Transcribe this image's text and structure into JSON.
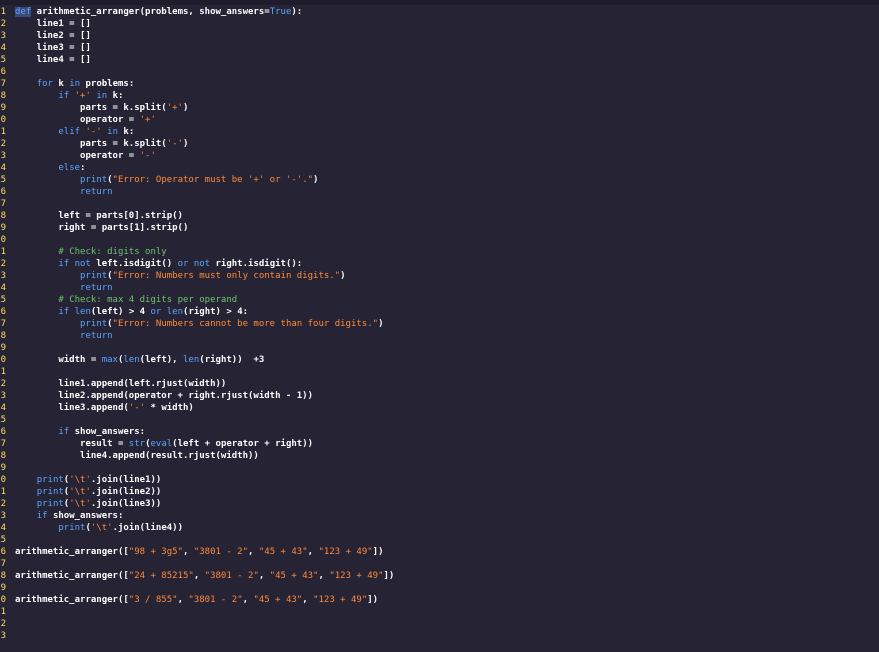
{
  "lines": [
    [
      [
        "sel",
        "def"
      ],
      [
        "p",
        " arithmetic_arranger(problems, show_answers="
      ],
      [
        "b",
        "True"
      ],
      [
        "p",
        "):"
      ]
    ],
    [
      [
        "p",
        "    line1 = []"
      ]
    ],
    [
      [
        "p",
        "    line2 = []"
      ]
    ],
    [
      [
        "p",
        "    line3 = []"
      ]
    ],
    [
      [
        "p",
        "    line4 = []"
      ]
    ],
    [],
    [
      [
        "p",
        "    "
      ],
      [
        "b",
        "for"
      ],
      [
        "p",
        " k "
      ],
      [
        "b",
        "in"
      ],
      [
        "p",
        " problems:"
      ]
    ],
    [
      [
        "p",
        "        "
      ],
      [
        "b",
        "if"
      ],
      [
        "p",
        " "
      ],
      [
        "s",
        "'+'"
      ],
      [
        "p",
        " "
      ],
      [
        "b",
        "in"
      ],
      [
        "p",
        " k:"
      ]
    ],
    [
      [
        "p",
        "            parts = k.split("
      ],
      [
        "s",
        "'+'"
      ],
      [
        "p",
        ")"
      ]
    ],
    [
      [
        "p",
        "            operator = "
      ],
      [
        "s",
        "'+'"
      ]
    ],
    [
      [
        "p",
        "        "
      ],
      [
        "b",
        "elif"
      ],
      [
        "p",
        " "
      ],
      [
        "s",
        "'-'"
      ],
      [
        "p",
        " "
      ],
      [
        "b",
        "in"
      ],
      [
        "p",
        " k:"
      ]
    ],
    [
      [
        "p",
        "            parts = k.split("
      ],
      [
        "s",
        "'-'"
      ],
      [
        "p",
        ")"
      ]
    ],
    [
      [
        "p",
        "            operator = "
      ],
      [
        "s",
        "'-'"
      ]
    ],
    [
      [
        "p",
        "        "
      ],
      [
        "b",
        "else"
      ],
      [
        "p",
        ":"
      ]
    ],
    [
      [
        "p",
        "            "
      ],
      [
        "b",
        "print"
      ],
      [
        "p",
        "("
      ],
      [
        "s",
        "\"Error: Operator must be '+' or '-'.\""
      ],
      [
        "p",
        ")"
      ]
    ],
    [
      [
        "p",
        "            "
      ],
      [
        "b",
        "return"
      ]
    ],
    [],
    [
      [
        "p",
        "        left = parts[0].strip()"
      ]
    ],
    [
      [
        "p",
        "        right = parts[1].strip()"
      ]
    ],
    [],
    [
      [
        "p",
        "        "
      ],
      [
        "c",
        "# Check: digits only"
      ]
    ],
    [
      [
        "p",
        "        "
      ],
      [
        "b",
        "if not"
      ],
      [
        "p",
        " left.isdigit() "
      ],
      [
        "b",
        "or not"
      ],
      [
        "p",
        " right.isdigit():"
      ]
    ],
    [
      [
        "p",
        "            "
      ],
      [
        "b",
        "print"
      ],
      [
        "p",
        "("
      ],
      [
        "s",
        "\"Error: Numbers must only contain digits.\""
      ],
      [
        "p",
        ")"
      ]
    ],
    [
      [
        "p",
        "            "
      ],
      [
        "b",
        "return"
      ]
    ],
    [
      [
        "p",
        "        "
      ],
      [
        "c",
        "# Check: max 4 digits per operand"
      ]
    ],
    [
      [
        "p",
        "        "
      ],
      [
        "b",
        "if"
      ],
      [
        "p",
        " "
      ],
      [
        "b",
        "len"
      ],
      [
        "p",
        "(left) > 4 "
      ],
      [
        "b",
        "or"
      ],
      [
        "p",
        " "
      ],
      [
        "b",
        "len"
      ],
      [
        "p",
        "(right) > 4:"
      ]
    ],
    [
      [
        "p",
        "            "
      ],
      [
        "b",
        "print"
      ],
      [
        "p",
        "("
      ],
      [
        "s",
        "\"Error: Numbers cannot be more than four digits.\""
      ],
      [
        "p",
        ")"
      ]
    ],
    [
      [
        "p",
        "            "
      ],
      [
        "b",
        "return"
      ]
    ],
    [],
    [
      [
        "p",
        "        width = "
      ],
      [
        "b",
        "max"
      ],
      [
        "p",
        "("
      ],
      [
        "b",
        "len"
      ],
      [
        "p",
        "(left), "
      ],
      [
        "b",
        "len"
      ],
      [
        "p",
        "(right))  +3"
      ]
    ],
    [],
    [
      [
        "p",
        "        line1.append(left.rjust(width))"
      ]
    ],
    [
      [
        "p",
        "        line2.append(operator + right.rjust(width - 1))"
      ]
    ],
    [
      [
        "p",
        "        line3.append("
      ],
      [
        "s",
        "'-'"
      ],
      [
        "p",
        " * width)"
      ]
    ],
    [],
    [
      [
        "p",
        "        "
      ],
      [
        "b",
        "if"
      ],
      [
        "p",
        " show_answers:"
      ]
    ],
    [
      [
        "p",
        "            result = "
      ],
      [
        "b",
        "str"
      ],
      [
        "p",
        "("
      ],
      [
        "b",
        "eval"
      ],
      [
        "p",
        "(left + operator + right))"
      ]
    ],
    [
      [
        "p",
        "            line4.append(result.rjust(width))"
      ]
    ],
    [],
    [
      [
        "p",
        "    "
      ],
      [
        "b",
        "print"
      ],
      [
        "p",
        "("
      ],
      [
        "s",
        "'\\t'"
      ],
      [
        "p",
        ".join(line1))"
      ]
    ],
    [
      [
        "p",
        "    "
      ],
      [
        "b",
        "print"
      ],
      [
        "p",
        "("
      ],
      [
        "s",
        "'\\t'"
      ],
      [
        "p",
        ".join(line2))"
      ]
    ],
    [
      [
        "p",
        "    "
      ],
      [
        "b",
        "print"
      ],
      [
        "p",
        "("
      ],
      [
        "s",
        "'\\t'"
      ],
      [
        "p",
        ".join(line3))"
      ]
    ],
    [
      [
        "p",
        "    "
      ],
      [
        "b",
        "if"
      ],
      [
        "p",
        " show_answers:"
      ]
    ],
    [
      [
        "p",
        "        "
      ],
      [
        "b",
        "print"
      ],
      [
        "p",
        "("
      ],
      [
        "s",
        "'\\t'"
      ],
      [
        "p",
        ".join(line4))"
      ]
    ],
    [],
    [
      [
        "p",
        "arithmetic_arranger(["
      ],
      [
        "s",
        "\"98 + 3g5\""
      ],
      [
        "p",
        ", "
      ],
      [
        "s",
        "\"3801 - 2\""
      ],
      [
        "p",
        ", "
      ],
      [
        "s",
        "\"45 + 43\""
      ],
      [
        "p",
        ", "
      ],
      [
        "s",
        "\"123 + 49\""
      ],
      [
        "p",
        "])"
      ]
    ],
    [],
    [
      [
        "p",
        "arithmetic_arranger(["
      ],
      [
        "s",
        "\"24 + 85215\""
      ],
      [
        "p",
        ", "
      ],
      [
        "s",
        "\"3801 - 2\""
      ],
      [
        "p",
        ", "
      ],
      [
        "s",
        "\"45 + 43\""
      ],
      [
        "p",
        ", "
      ],
      [
        "s",
        "\"123 + 49\""
      ],
      [
        "p",
        "])"
      ]
    ],
    [],
    [
      [
        "p",
        "arithmetic_arranger(["
      ],
      [
        "s",
        "\"3 / 855\""
      ],
      [
        "p",
        ", "
      ],
      [
        "s",
        "\"3801 - 2\""
      ],
      [
        "p",
        ", "
      ],
      [
        "s",
        "\"45 + 43\""
      ],
      [
        "p",
        ", "
      ],
      [
        "s",
        "\"123 + 49\""
      ],
      [
        "p",
        "])"
      ]
    ]
  ],
  "gutter_numbers": [
    "1",
    "2",
    "3",
    "4",
    "5",
    "6",
    "7",
    "8",
    "9",
    "0",
    "1",
    "2",
    "3",
    "4",
    "5",
    "6",
    "7",
    "8",
    "9",
    "0",
    "1",
    "2",
    "3",
    "4",
    "5",
    "6",
    "7",
    "8",
    "9",
    "0",
    "1",
    "2",
    "3",
    "4",
    "5",
    "6",
    "7",
    "8",
    "9",
    "0",
    "1",
    "2",
    "3",
    "4",
    "5",
    "6",
    "7",
    "8",
    "9",
    "0",
    "1",
    "2",
    "3"
  ],
  "colors": {
    "background": "#262335",
    "keyword": "#5aa6ff",
    "string": "#ff8b39",
    "comment": "#6ec36e",
    "text": "#ffffff",
    "gutter": "#fede5d"
  }
}
